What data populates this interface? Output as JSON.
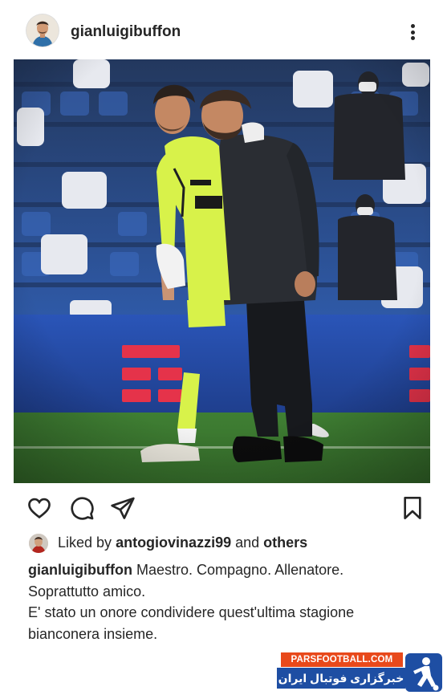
{
  "post": {
    "username": "gianluigibuffon",
    "photo_alt": "Buffon and Pirlo embracing on the pitch"
  },
  "likes": {
    "prefix": "Liked by",
    "user": "antogiovinazzi99",
    "conjunction": "and",
    "others": "others"
  },
  "caption": {
    "username": "gianluigibuffon",
    "line1": "Maestro. Compagno. Allenatore.",
    "line2": "Soprattutto amico.",
    "line3": "E' stato un onore condividere quest'ultima stagione",
    "line4": "bianconera insieme."
  },
  "watermark": {
    "site": "PARSFOOTBALL.COM",
    "tagline": "خبرگزاری فوتبال ایران"
  },
  "colors": {
    "text": "#262626",
    "pitch_green": "#3e7a31",
    "goalkeeper_kit": "#d8f24a",
    "watermark_orange": "#e8491b",
    "watermark_blue": "#1e4ea3"
  },
  "icons": [
    "more-icon",
    "heart-icon",
    "comment-icon",
    "share-icon",
    "bookmark-icon"
  ]
}
